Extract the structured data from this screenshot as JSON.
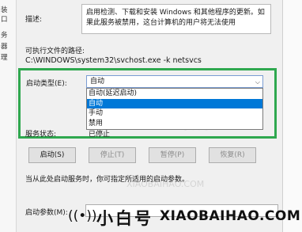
{
  "left_strip": [
    "装",
    "口",
    "务",
    "器",
    "理"
  ],
  "description": {
    "label": "描述:",
    "text": "启用检测、下载和安装 Windows 和其他程序的更新。如果此服务被禁用，这台计算机的用户将无法使用"
  },
  "exe_path": {
    "label": "可执行文件的路径:",
    "value": "C:\\WINDOWS\\system32\\svchost.exe -k netsvcs"
  },
  "startup_type": {
    "label": "启动类型(E):",
    "selected": "自动",
    "options": [
      "自动(延迟启动)",
      "自动",
      "手动",
      "禁用"
    ],
    "highlighted_index": 1
  },
  "service_status": {
    "label": "服务状态:",
    "value": "已停止"
  },
  "buttons": {
    "start": "启动(S)",
    "stop": "停止(T)",
    "pause": "暂停(P)",
    "resume": "恢复(R)"
  },
  "hint": "当从此处启动服务时，你可指定所适用的启动参数。",
  "start_params": {
    "label": "启动参数(M):",
    "value": ""
  },
  "watermark": {
    "cn": "小白号",
    "en": "XIAOBAIHAO.COM",
    "signal_glyph": "((•))"
  },
  "colors": {
    "highlight_frame": "#2fa84f",
    "selection": "#0078d7"
  }
}
